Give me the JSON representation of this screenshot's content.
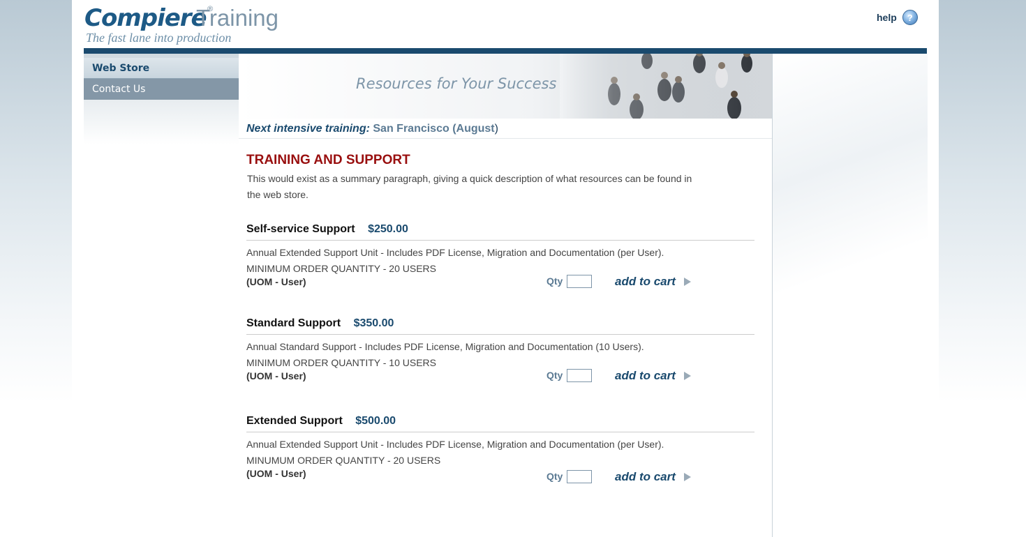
{
  "brand": {
    "name": "Compiere",
    "registered": "®",
    "product": "Training",
    "tagline": "The fast lane into production"
  },
  "help": {
    "label": "help",
    "icon": "question-icon",
    "icon_glyph": "?"
  },
  "nav": {
    "items": [
      {
        "label": "Web Store",
        "active": true
      },
      {
        "label": "Contact Us",
        "active": false
      }
    ]
  },
  "banner": {
    "text": "Resources for Your Success"
  },
  "next_training": {
    "label": "Next intensive training:",
    "city": "San Francisco (August",
    "close": ")"
  },
  "section": {
    "title": "TRAINING AND SUPPORT",
    "summary": "This would exist as a summary paragraph, giving a quick description of what resources can be found in the web store."
  },
  "products": [
    {
      "title": "Self-service Support",
      "price": "$250.00",
      "desc1": "Annual Extended Support Unit - Includes PDF License, Migration and Documentation (per User).",
      "desc2": "MINIMUM ORDER QUANTITY  -  20 USERS",
      "uom": "(UOM - User)",
      "qty_label": "Qty",
      "qty_value": "",
      "cart_label": "add to cart"
    },
    {
      "title": "Standard Support",
      "price": "$350.00",
      "desc1": "Annual Standard Support - Includes PDF License, Migration and Documentation (10 Users).",
      "desc2": "MINIMUM ORDER QUANTITY -  10 USERS",
      "uom": "(UOM - User)",
      "qty_label": "Qty",
      "qty_value": "",
      "cart_label": "add to cart"
    },
    {
      "title": "Extended Support",
      "price": "$500.00",
      "desc1": "Annual Extended Support Unit - Includes PDF License, Migration and Documentation (per User).",
      "desc2": "MINUMUM ORDER QUANTITY  -  20 USERS",
      "uom": "(UOM - User)",
      "qty_label": "Qty",
      "qty_value": "",
      "cart_label": "add to cart"
    }
  ],
  "colors": {
    "brand_blue": "#1a4a6e",
    "title_red": "#990f0f",
    "muted_blue": "#7d95a8"
  }
}
